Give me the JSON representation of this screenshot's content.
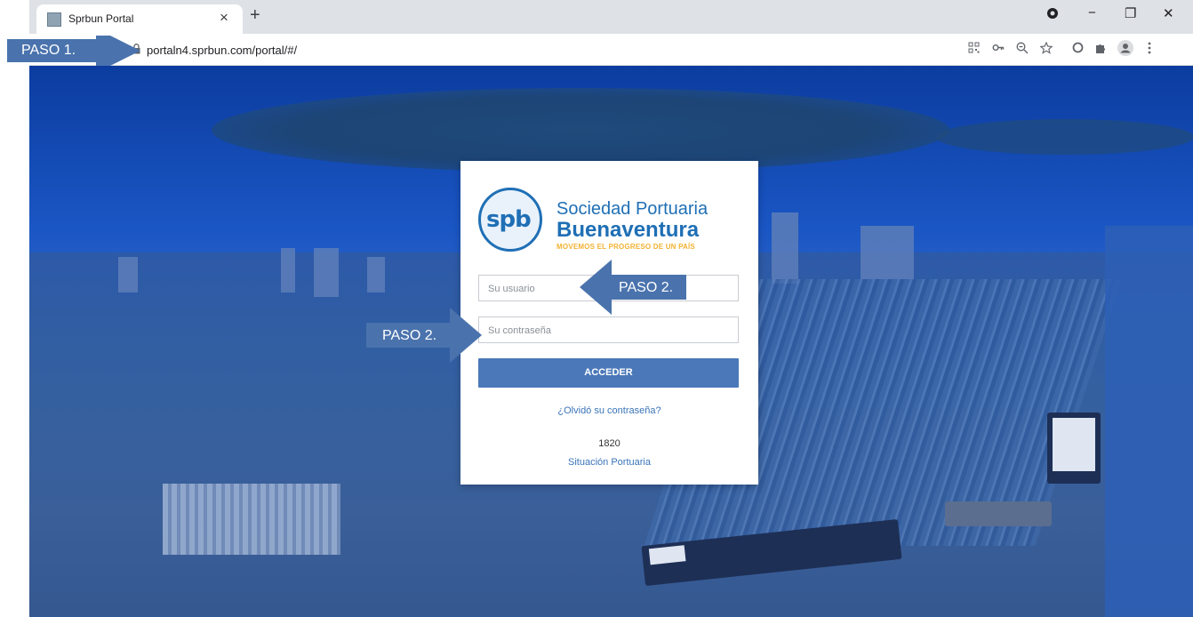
{
  "browser": {
    "tab_title": "Sprbun Portal",
    "tab_close": "×",
    "new_tab": "+",
    "url": "portaln4.sprbun.com/portal/#/",
    "win_minimize": "−",
    "win_restore": "❐",
    "win_close": "✕"
  },
  "logo": {
    "mark": "spb",
    "line1": "Sociedad Portuaria",
    "line2": "Buenaventura",
    "line3": "MOVEMOS EL PROGRESO DE UN PAÍS"
  },
  "login": {
    "user_placeholder": "Su usuario",
    "password_placeholder": "Su contraseña",
    "submit_label": "ACCEDER",
    "forgot_link": "¿Olvidó su contraseña?",
    "year": "1820",
    "situacion_link": "Situación Portuaria"
  },
  "annotations": {
    "step1": "PASO 1.",
    "step2_user": "PASO 2.",
    "step2_password": "PASO 2."
  },
  "colors": {
    "brand_blue": "#1f6fb5",
    "brand_yellow": "#f2b233",
    "button": "#4a78b8",
    "annotation": "#4a73ad"
  }
}
